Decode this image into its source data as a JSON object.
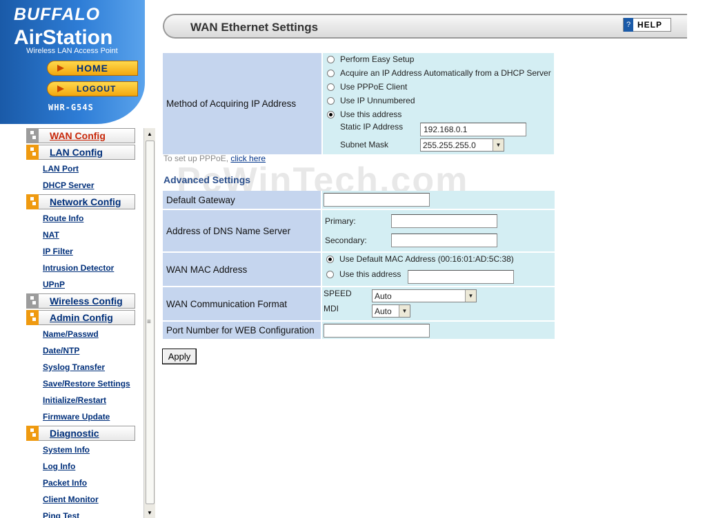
{
  "brand": {
    "company": "BUFFALO",
    "product": "AirStation",
    "subtitle": "Wireless LAN Access Point",
    "model": "WHR-G54S"
  },
  "nav": {
    "home_label": "HOME",
    "logout_label": "LOGOUT"
  },
  "menu": {
    "wan_config": "WAN Config",
    "lan_config": "LAN Config",
    "lan_items": [
      "LAN Port",
      "DHCP Server"
    ],
    "network_config": "Network Config",
    "network_items": [
      "Route Info",
      "NAT",
      "IP Filter",
      "Intrusion Detector",
      "UPnP"
    ],
    "wireless_config": "Wireless Config",
    "admin_config": "Admin Config",
    "admin_items": [
      "Name/Passwd",
      "Date/NTP",
      "Syslog Transfer",
      "Save/Restore Settings",
      "Initialize/Restart",
      "Firmware Update"
    ],
    "diagnostic": "Diagnostic",
    "diagnostic_items": [
      "System Info",
      "Log Info",
      "Packet Info",
      "Client Monitor",
      "Ping Test"
    ]
  },
  "page": {
    "title": "WAN Ethernet Settings",
    "help_label": "HELP"
  },
  "method": {
    "label": "Method of Acquiring IP Address",
    "options": [
      "Perform Easy Setup",
      "Acquire an IP Address Automatically from a DHCP Server",
      "Use PPPoE Client",
      "Use IP Unnumbered",
      "Use this address"
    ],
    "selected_index": 4,
    "static_ip_label": "Static IP Address",
    "static_ip_value": "192.168.0.1",
    "subnet_label": "Subnet Mask",
    "subnet_value": "255.255.255.0"
  },
  "pppoe_note": {
    "text": "To set up PPPoE, ",
    "link": "click here"
  },
  "watermark": "PcWinTech.com",
  "advanced": {
    "title": "Advanced Settings",
    "gateway_label": "Default Gateway",
    "gateway_value": "",
    "dns_label": "Address of DNS Name Server",
    "dns_primary_label": "Primary:",
    "dns_primary_value": "",
    "dns_secondary_label": "Secondary:",
    "dns_secondary_value": "",
    "mac_label": "WAN MAC Address",
    "mac_default": "Use Default MAC Address (00:16:01:AD:5C:38)",
    "mac_custom": "Use this address",
    "mac_custom_value": "",
    "comm_label": "WAN Communication Format",
    "speed_label": "SPEED",
    "speed_value": "Auto",
    "mdi_label": "MDI",
    "mdi_value": "Auto",
    "port_label": "Port Number for WEB Configuration",
    "port_value": ""
  },
  "apply_label": "Apply"
}
